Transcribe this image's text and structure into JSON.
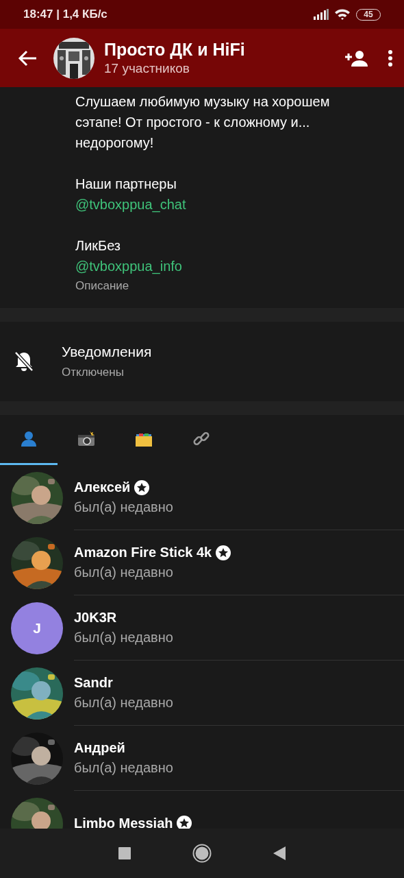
{
  "status_bar": {
    "time": "18:47 | 1,4 КБ/с",
    "battery": "45"
  },
  "header": {
    "title": "Просто ДК и HiFi",
    "subtitle": "17 участников"
  },
  "description": {
    "blocks": [
      {
        "kind": "text",
        "lines": [
          "Слушаем любимую музыку на хорошем",
          "сэтапе! От простого - к сложному и...",
          "недорогому!"
        ]
      },
      {
        "kind": "text",
        "lines": [
          "Наши партнеры"
        ]
      },
      {
        "kind": "link",
        "lines": [
          "@tvboxppua_chat"
        ]
      },
      {
        "kind": "gap"
      },
      {
        "kind": "text",
        "lines": [
          "ЛикБез"
        ]
      },
      {
        "kind": "link",
        "lines": [
          "@tvboxppua_info"
        ]
      }
    ],
    "caption": "Описание"
  },
  "notifications": {
    "title": "Уведомления",
    "value": "Отключены",
    "muted": true
  },
  "tabs": [
    {
      "kind": "members",
      "selected": true
    },
    {
      "kind": "media",
      "selected": false
    },
    {
      "kind": "files",
      "selected": false
    },
    {
      "kind": "links",
      "selected": false
    }
  ],
  "members": [
    {
      "name": "Алексей",
      "verified": true,
      "status": "был(а) недавно"
    },
    {
      "name": "Amazon Fire Stick 4k",
      "verified": true,
      "status": "был(а) недавно"
    },
    {
      "name": "J0K3R",
      "verified": false,
      "status": "был(а) недавно",
      "avatar": {
        "kind": "letter",
        "letter": "J",
        "color": "#9381e0"
      }
    },
    {
      "name": "Sandr",
      "verified": false,
      "status": "был(а) недавно"
    },
    {
      "name": "Андрей",
      "verified": false,
      "status": "был(а) недавно"
    },
    {
      "name": "Limbo Messiah",
      "verified": true
    }
  ]
}
